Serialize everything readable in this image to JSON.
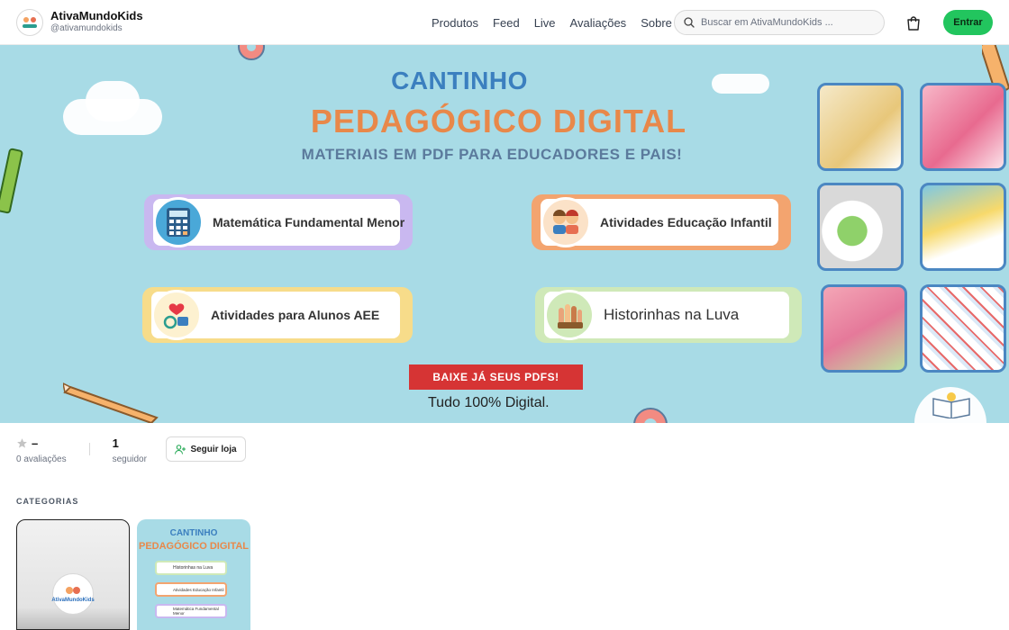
{
  "header": {
    "store_name": "AtivaMundoKids",
    "store_handle": "@ativamundokids",
    "logo_icon": "ativamundokids-logo",
    "nav": [
      "Produtos",
      "Feed",
      "Live",
      "Avaliações",
      "Sobre"
    ],
    "search_placeholder": "Buscar em AtivaMundoKids ...",
    "cart_icon": "shopping-bag-icon",
    "login_label": "Entrar"
  },
  "banner": {
    "title_line1": "CANTINHO",
    "title_line2": "PEDAGÓGICO DIGITAL",
    "title_line3": "MATERIAIS EM PDF PARA EDUCADORES E PAIS!",
    "pills": [
      "Matemática Fundamental Menor",
      "Atividades Educação Infantil",
      "Atividades para Alunos AEE",
      "Historinhas na Luva"
    ],
    "cta": "BAIXE JÁ SEUS PDFS!",
    "tagline": "Tudo 100% Digital.",
    "colors": {
      "background": "#a8dbe6",
      "title_blue": "#3b7fbf",
      "title_orange": "#e8884a",
      "cta_red": "#d63434"
    }
  },
  "stats": {
    "rating_value": "–",
    "rating_label": "0 avaliações",
    "followers_value": "1",
    "followers_label": "seguidor",
    "follow_label": "Seguir loja"
  },
  "categories": {
    "title": "CATEGORIAS",
    "card1_logo_text": "AtivaMundoKids",
    "card2": {
      "title1": "CANTINHO",
      "title2": "PEDAGÓGICO DIGITAL",
      "items": [
        "Historinhas na Luva",
        "Atividades Educação Infantil",
        "Matemática Fundamental Menor"
      ]
    }
  },
  "accent_color": "#22c55e"
}
